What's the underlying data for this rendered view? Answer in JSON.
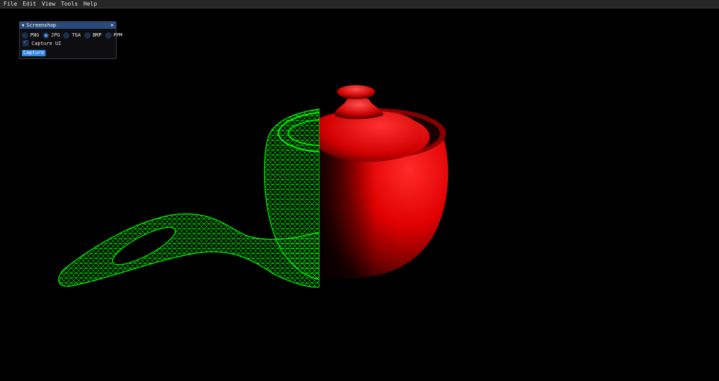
{
  "menubar": {
    "items": [
      "File",
      "Edit",
      "View",
      "Tools",
      "Help"
    ]
  },
  "screenshot_window": {
    "title": "Screenshop",
    "collapse_icon": "triangle-down-icon",
    "close_icon": "close-icon",
    "formats": [
      {
        "label": "PNG",
        "selected": false
      },
      {
        "label": "JPG",
        "selected": true
      },
      {
        "label": "TGA",
        "selected": false
      },
      {
        "label": "BMP",
        "selected": false
      },
      {
        "label": "PPM",
        "selected": false
      }
    ],
    "capture_ui_label": "Capture UI",
    "capture_ui_checked": true,
    "capture_button_label": "Capture"
  },
  "scene": {
    "background": "#000000",
    "wireframe_color": "#00ff00",
    "solid_color": "#ff0000"
  }
}
